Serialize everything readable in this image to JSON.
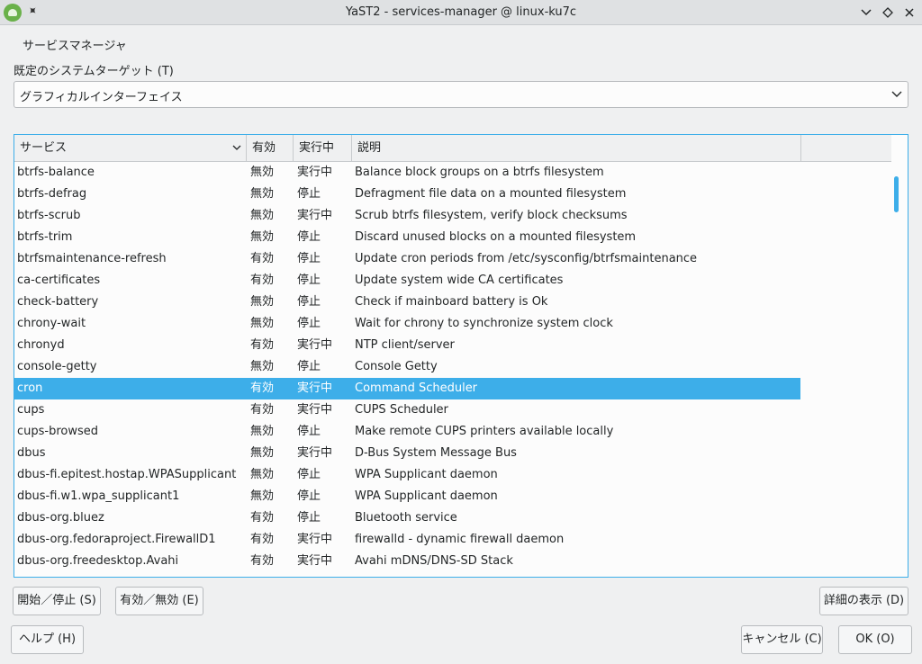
{
  "window": {
    "title": "YaST2 - services-manager @ linux-ku7c",
    "pin_glyph": "✦",
    "minimize_glyph": "⌄",
    "maximize_glyph": "◇",
    "close_glyph": "✕"
  },
  "heading": "サービスマネージャ",
  "target": {
    "label": "既定のシステムターゲット (T)",
    "value": "グラフィカルインターフェイス"
  },
  "table": {
    "columns": [
      "サービス",
      "有効",
      "実行中",
      "説明"
    ],
    "selected_index": 10,
    "rows": [
      {
        "name": "btrfs-balance",
        "enabled": "無効",
        "state": "実行中",
        "desc": "Balance block groups on a btrfs filesystem"
      },
      {
        "name": "btrfs-defrag",
        "enabled": "無効",
        "state": "停止",
        "desc": "Defragment file data on a mounted filesystem"
      },
      {
        "name": "btrfs-scrub",
        "enabled": "無効",
        "state": "実行中",
        "desc": "Scrub btrfs filesystem, verify block checksums"
      },
      {
        "name": "btrfs-trim",
        "enabled": "無効",
        "state": "停止",
        "desc": "Discard unused blocks on a mounted filesystem"
      },
      {
        "name": "btrfsmaintenance-refresh",
        "enabled": "有効",
        "state": "停止",
        "desc": "Update cron periods from /etc/sysconfig/btrfsmaintenance"
      },
      {
        "name": "ca-certificates",
        "enabled": "有効",
        "state": "停止",
        "desc": "Update system wide CA certificates"
      },
      {
        "name": "check-battery",
        "enabled": "無効",
        "state": "停止",
        "desc": "Check if mainboard battery is Ok"
      },
      {
        "name": "chrony-wait",
        "enabled": "無効",
        "state": "停止",
        "desc": "Wait for chrony to synchronize system clock"
      },
      {
        "name": "chronyd",
        "enabled": "有効",
        "state": "実行中",
        "desc": "NTP client/server"
      },
      {
        "name": "console-getty",
        "enabled": "無効",
        "state": "停止",
        "desc": "Console Getty"
      },
      {
        "name": "cron",
        "enabled": "有効",
        "state": "実行中",
        "desc": "Command Scheduler"
      },
      {
        "name": "cups",
        "enabled": "有効",
        "state": "実行中",
        "desc": "CUPS Scheduler"
      },
      {
        "name": "cups-browsed",
        "enabled": "無効",
        "state": "停止",
        "desc": "Make remote CUPS printers available locally"
      },
      {
        "name": "dbus",
        "enabled": "無効",
        "state": "実行中",
        "desc": "D-Bus System Message Bus"
      },
      {
        "name": "dbus-fi.epitest.hostap.WPASupplicant",
        "enabled": "無効",
        "state": "停止",
        "desc": "WPA Supplicant daemon"
      },
      {
        "name": "dbus-fi.w1.wpa_supplicant1",
        "enabled": "無効",
        "state": "停止",
        "desc": "WPA Supplicant daemon"
      },
      {
        "name": "dbus-org.bluez",
        "enabled": "有効",
        "state": "停止",
        "desc": "Bluetooth service"
      },
      {
        "name": "dbus-org.fedoraproject.FirewallD1",
        "enabled": "有効",
        "state": "実行中",
        "desc": "firewalld - dynamic firewall daemon"
      },
      {
        "name": "dbus-org.freedesktop.Avahi",
        "enabled": "有効",
        "state": "実行中",
        "desc": "Avahi mDNS/DNS-SD Stack"
      }
    ]
  },
  "buttons": {
    "start_stop": "開始／停止 (S)",
    "enable_disable": "有効／無効 (E)",
    "details": "詳細の表示 (D)",
    "help": "ヘルプ (H)",
    "cancel": "キャンセル (C)",
    "ok": "OK (O)"
  },
  "colors": {
    "accent": "#3daee9",
    "background": "#eff0f1"
  }
}
